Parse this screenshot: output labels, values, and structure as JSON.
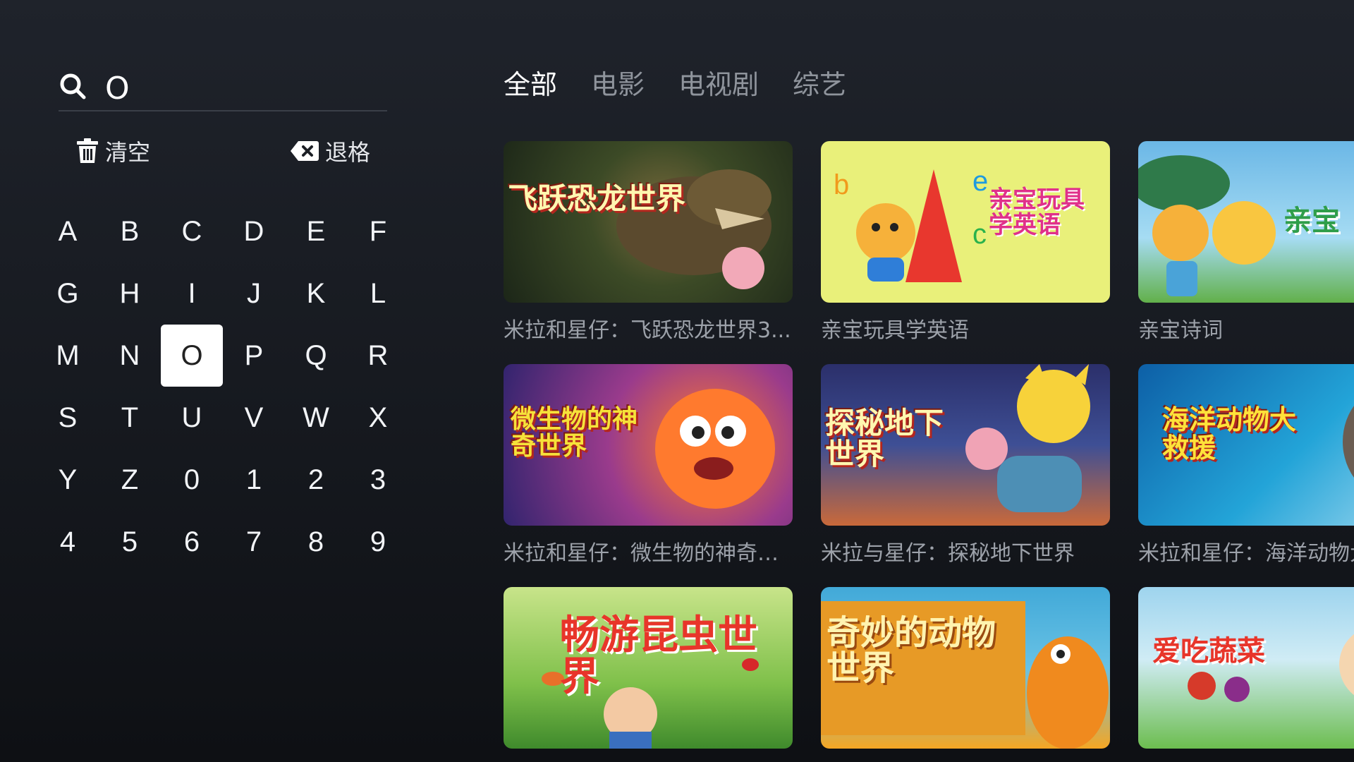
{
  "search": {
    "query": "O"
  },
  "actions": {
    "clear_label": "清空",
    "backspace_label": "退格"
  },
  "keyboard": {
    "keys": [
      "A",
      "B",
      "C",
      "D",
      "E",
      "F",
      "G",
      "H",
      "I",
      "J",
      "K",
      "L",
      "M",
      "N",
      "O",
      "P",
      "Q",
      "R",
      "S",
      "T",
      "U",
      "V",
      "W",
      "X",
      "Y",
      "Z",
      "0",
      "1",
      "2",
      "3",
      "4",
      "5",
      "6",
      "7",
      "8",
      "9"
    ],
    "active_key": "O"
  },
  "tabs": [
    {
      "label": "全部",
      "active": true
    },
    {
      "label": "电影",
      "active": false
    },
    {
      "label": "电视剧",
      "active": false
    },
    {
      "label": "综艺",
      "active": false
    }
  ],
  "results": [
    {
      "caption": "米拉和星仔：飞跃恐龙世界3...",
      "art_text": "飞跃恐龙世界"
    },
    {
      "caption": "亲宝玩具学英语",
      "art_text": "亲宝玩具学英语"
    },
    {
      "caption": "亲宝诗词",
      "art_text": "亲宝"
    },
    {
      "caption": "米拉和星仔：微生物的神奇世...",
      "art_text": "微生物的神奇世界"
    },
    {
      "caption": "米拉与星仔：探秘地下世界",
      "art_text": "探秘地下世界"
    },
    {
      "caption": "米拉和星仔：海洋动物大救援",
      "art_text": "海洋动物大救援"
    },
    {
      "caption": "",
      "art_text": "畅游昆虫世界"
    },
    {
      "caption": "",
      "art_text": "奇妙的动物世界"
    },
    {
      "caption": "",
      "art_text": "爱吃蔬菜"
    }
  ],
  "colors": {
    "background": "#1a1d23",
    "active_tab": "#ffffff",
    "inactive_tab": "#8f949c",
    "caption": "#9da2aa",
    "active_key_bg": "#ffffff"
  }
}
